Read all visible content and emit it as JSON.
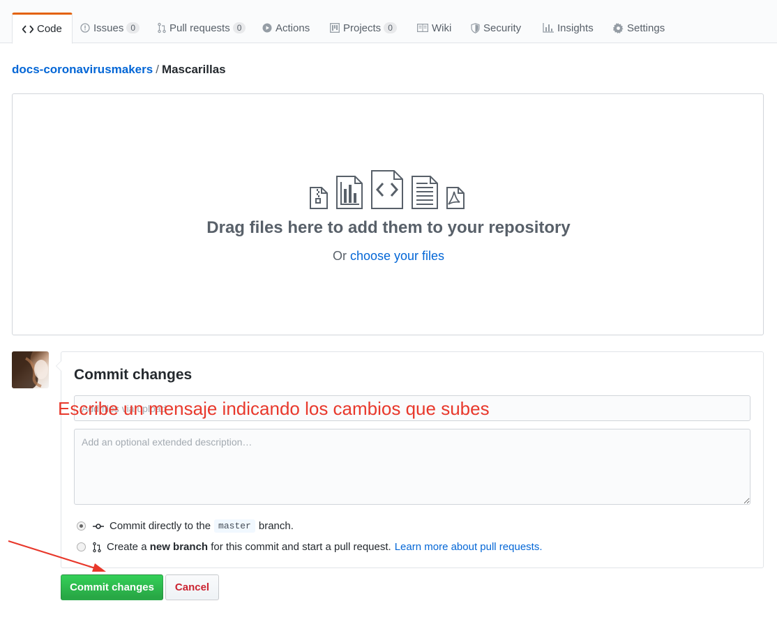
{
  "tabs": [
    {
      "label": "Code",
      "icon": "code-icon",
      "counter": null,
      "selected": true
    },
    {
      "label": "Issues",
      "icon": "issue-icon",
      "counter": "0"
    },
    {
      "label": "Pull requests",
      "icon": "pull-request-icon",
      "counter": "0"
    },
    {
      "label": "Actions",
      "icon": "play-icon",
      "counter": null
    },
    {
      "label": "Projects",
      "icon": "project-icon",
      "counter": "0"
    },
    {
      "label": "Wiki",
      "icon": "book-icon",
      "counter": null
    },
    {
      "label": "Security",
      "icon": "shield-icon",
      "counter": null
    },
    {
      "label": "Insights",
      "icon": "graph-icon",
      "counter": null
    },
    {
      "label": "Settings",
      "icon": "gear-icon",
      "counter": null
    }
  ],
  "breadcrumb": {
    "repo": "docs-coronavirusmakers",
    "separator": "/",
    "folder": "Mascarillas"
  },
  "dropzone": {
    "title": "Drag files here to add them to your repository",
    "prefix": "Or",
    "link": "choose your files"
  },
  "commit": {
    "title": "Commit changes",
    "summary_placeholder": "Add files via upload",
    "description_placeholder": "Add an optional extended description…",
    "option_direct": {
      "prefix": "Commit directly to the",
      "branch": "master",
      "suffix": "branch."
    },
    "option_new_branch": {
      "prefix": "Create a",
      "bold": "new branch",
      "suffix": "for this commit and start a pull request.",
      "link": "Learn more about pull requests."
    },
    "commit_button": "Commit changes",
    "cancel_button": "Cancel"
  },
  "annotation": {
    "text": "Escribe un mensaje indicando los cambios que subes",
    "color": "#e8382b"
  },
  "colors": {
    "accent_tab": "#e36209",
    "link": "#0366d6",
    "commit_green": "#28a745",
    "cancel_red": "#cb2431"
  }
}
